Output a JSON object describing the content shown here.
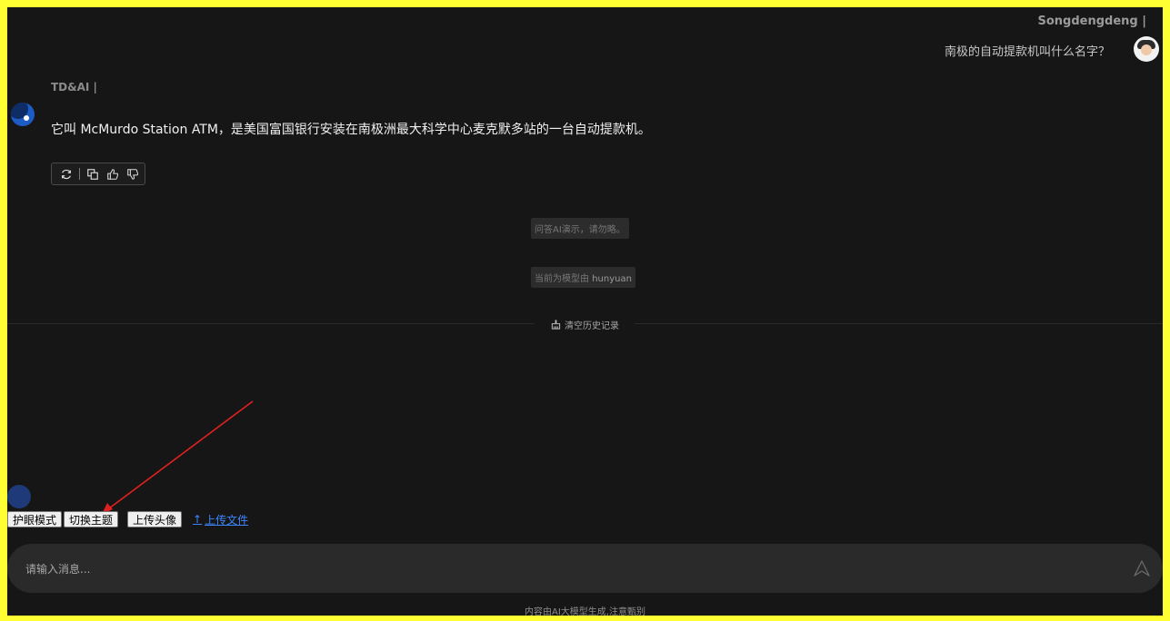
{
  "header": {
    "user_name": "Songdengdeng  |"
  },
  "user_message": {
    "text": "南极的自动提款机叫什么名字？"
  },
  "assistant": {
    "name": "TD&AI  |",
    "message": "它叫 McMurdo Station ATM，是美国富国银行安装在南极洲最大科学中心麦克默多站的一台自动提款机。",
    "actions": [
      "refresh-icon",
      "copy-icon",
      "thumbs-up-icon",
      "thumbs-down-icon"
    ]
  },
  "notices": {
    "demo": "问答AI演示，请勿略。",
    "model_prefix": "当前为模型由 ",
    "model_name": "hunyuan"
  },
  "clear_history": {
    "label": "清空历史记录"
  },
  "toolbar": {
    "eye_mode": "护眼模式",
    "switch_theme": "切换主题",
    "upload_avatar": "上传头像",
    "upload_file": "上传文件"
  },
  "input": {
    "placeholder": "请输入消息..."
  },
  "footer": {
    "note": "内容由AI大模型生成,注意甄别"
  },
  "colors": {
    "background": "#161616",
    "frame": "#ffff33",
    "link": "#3c86ff",
    "arrow": "#e02020"
  }
}
